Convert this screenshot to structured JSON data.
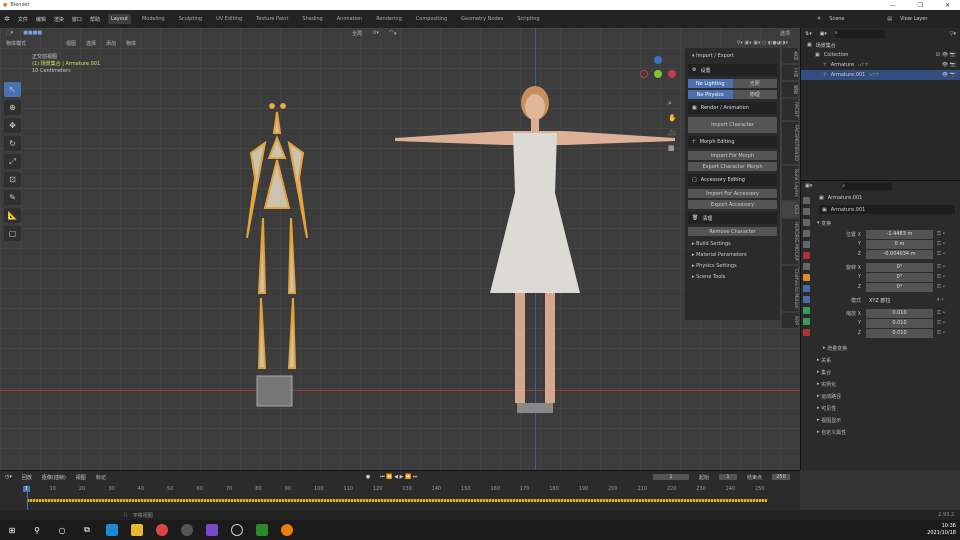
{
  "window": {
    "title": "Blender",
    "minimize": "—",
    "maximize": "❐",
    "close": "✕"
  },
  "menu": [
    "文件",
    "编辑",
    "渲染",
    "窗口",
    "帮助"
  ],
  "workspaces": [
    "Layout",
    "Modeling",
    "Sculpting",
    "UV Editing",
    "Texture Paint",
    "Shading",
    "Animation",
    "Rendering",
    "Compositing",
    "Geometry Nodes",
    "Scripting"
  ],
  "scene": {
    "label": "Scene",
    "view_layer": "View Layer"
  },
  "viewport": {
    "mode": "物体模式",
    "menus": [
      "视图",
      "选择",
      "添加",
      "物体"
    ],
    "orientation": "全局",
    "options": "选项",
    "overlay_title": "正交前视图",
    "overlay_object": "(1) 场景集合 | Armature.001",
    "overlay_scale": "10 Centimeters"
  },
  "npanel": {
    "header": "Import / Export",
    "settings": "设置",
    "no_lighting": "No Lighting",
    "lighting": "光照",
    "no_physics": "No Physics",
    "physics": "物理",
    "render_anim": "Render / Animation",
    "import_character": "Import Character",
    "morph_editing": "Morph Editing",
    "import_for_morph": "Import For Morph",
    "export_character_morph": "Export Character Morph",
    "accessory_editing": "Accessory Editing",
    "import_for_accessory": "Import For Accessory",
    "export_accessory": "Export Accessory",
    "cleanup": "清理",
    "remove_character": "Remove Character",
    "subpanels": [
      "Build Settings",
      "Material Parameters",
      "Physics Settings",
      "Scene Tools"
    ]
  },
  "side_tabs": [
    "条目",
    "工具",
    "视图",
    "FACEIT",
    "FACEMOTION3D",
    "Bone Layers",
    "CC3",
    "HEADRIG MOCAP",
    "Clothes to Motion",
    "ARP"
  ],
  "outliner": {
    "root": "场景集合",
    "items": [
      "Collection",
      "Armature",
      "Armature.001"
    ]
  },
  "properties": {
    "object": "Armature.001",
    "name_field": "Armature.001",
    "transform": "变换",
    "location_label": "位置 X",
    "loc": [
      "-1.4483 m",
      "0 m",
      "-0.004034 m"
    ],
    "rotation_label": "旋转 X",
    "rot": [
      "0°",
      "0°",
      "0°"
    ],
    "mode_label": "模式",
    "mode": "XYZ 欧拉",
    "scale_label": "缩放 X",
    "scale": [
      "0.010",
      "0.010",
      "0.010"
    ],
    "axis_y": "Y",
    "axis_z": "Z",
    "delta": "增量变换",
    "sections": [
      "关系",
      "集合",
      "实例化",
      "运动路径",
      "可见性",
      "视图显示",
      "自定义属性"
    ]
  },
  "timeline": {
    "menus": [
      "回放",
      "抠像(插帧)",
      "视图",
      "标记"
    ],
    "current": "1",
    "start_label": "起始",
    "start": "1",
    "end_label": "结束点",
    "end": "250",
    "ticks": [
      "1",
      "10",
      "20",
      "30",
      "40",
      "50",
      "60",
      "70",
      "80",
      "90",
      "100",
      "110",
      "120",
      "130",
      "140",
      "150",
      "160",
      "170",
      "180",
      "190",
      "200",
      "210",
      "220",
      "230",
      "240",
      "250"
    ]
  },
  "status": {
    "hint": "平移视图",
    "version": "2.93.2"
  },
  "taskbar": {
    "time": "10:36",
    "date": "2021/10/18"
  }
}
